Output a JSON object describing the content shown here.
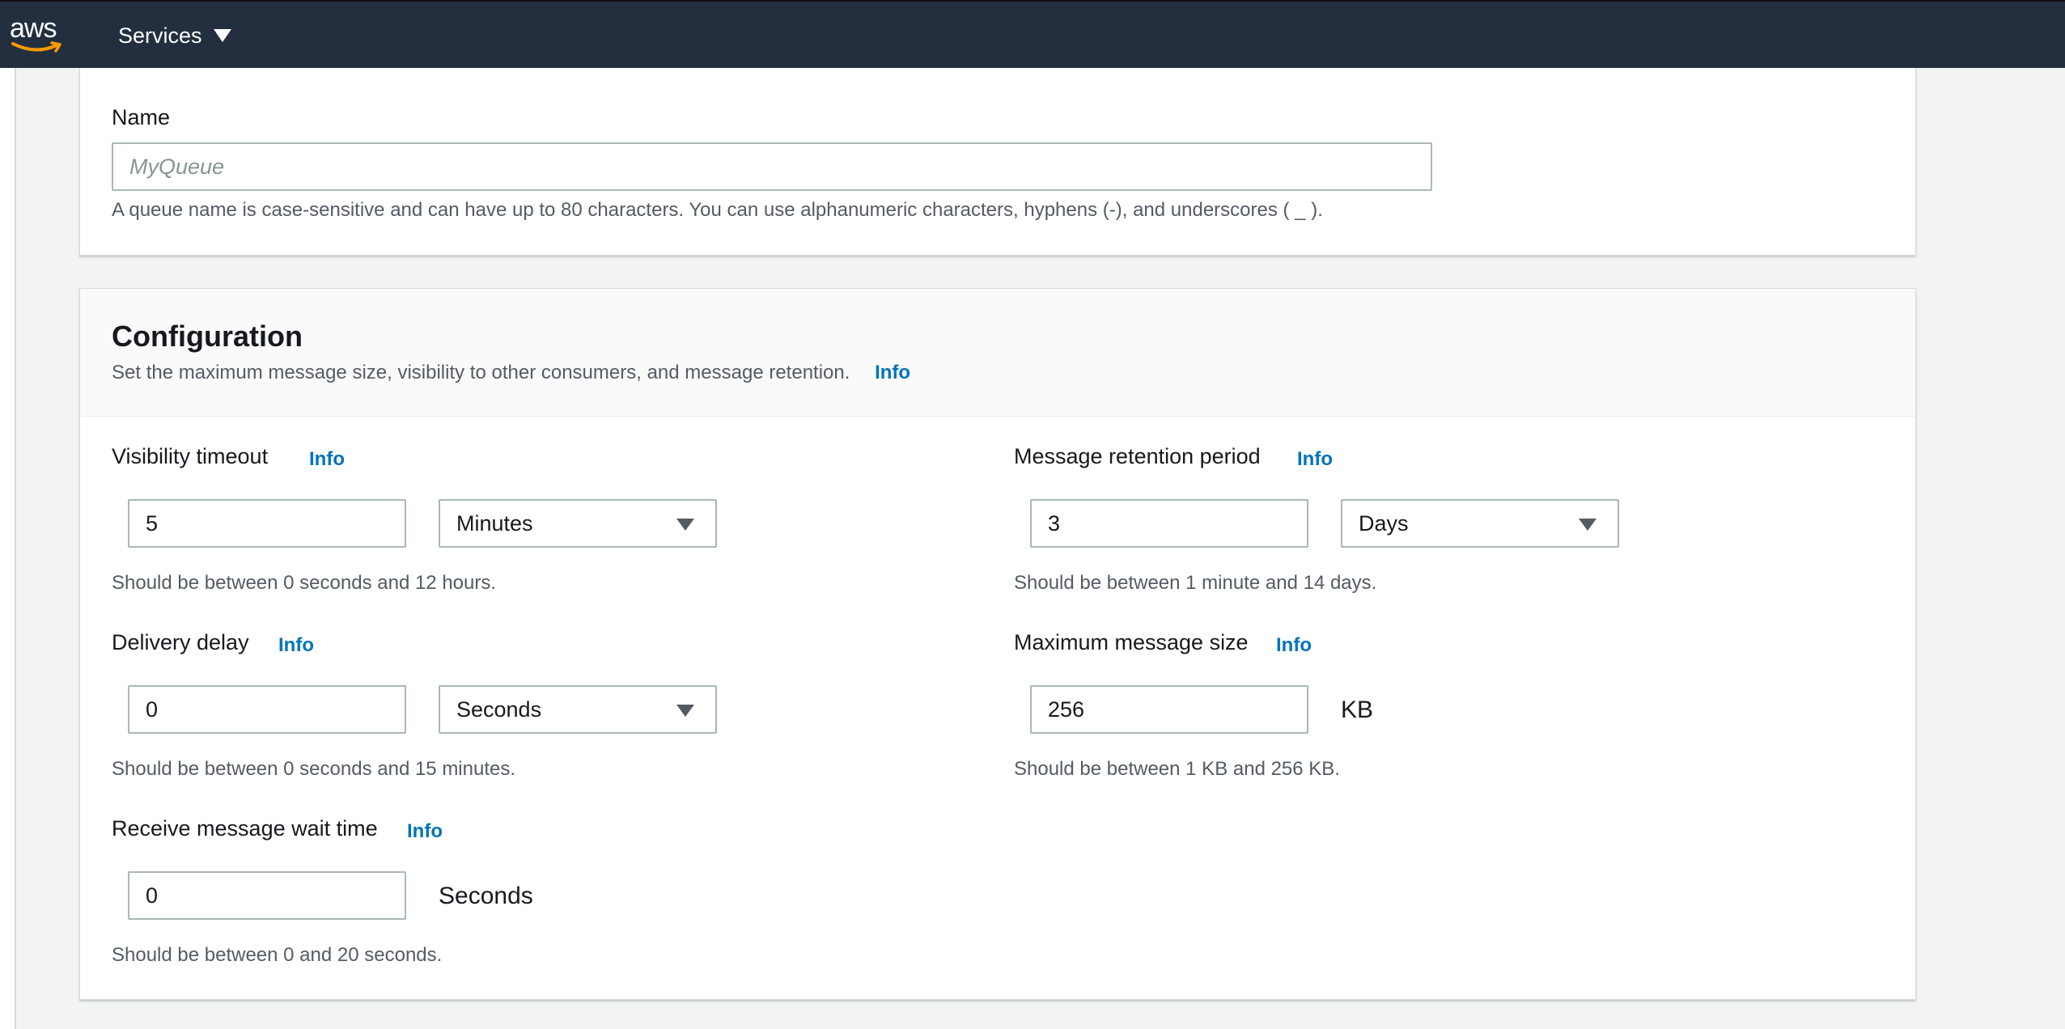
{
  "nav": {
    "logo_text": "aws",
    "services_label": "Services"
  },
  "name_section": {
    "label": "Name",
    "placeholder": "MyQueue",
    "value": "",
    "hint": "A queue name is case-sensitive and can have up to 80 characters. You can use alphanumeric characters, hyphens (-), and underscores ( _ )."
  },
  "configuration": {
    "title": "Configuration",
    "description": "Set the maximum message size, visibility to other consumers, and message retention.",
    "info": "Info",
    "visibility_timeout": {
      "label": "Visibility timeout",
      "info": "Info",
      "value": "5",
      "unit": "Minutes",
      "hint": "Should be between 0 seconds and 12 hours."
    },
    "delivery_delay": {
      "label": "Delivery delay",
      "info": "Info",
      "value": "0",
      "unit": "Seconds",
      "hint": "Should be between 0 seconds and 15 minutes."
    },
    "receive_wait_time": {
      "label": "Receive message wait time",
      "info": "Info",
      "value": "0",
      "unit": "Seconds",
      "hint": "Should be between 0 and 20 seconds."
    },
    "retention_period": {
      "label": "Message retention period",
      "info": "Info",
      "value": "3",
      "unit": "Days",
      "hint": "Should be between 1 minute and 14 days."
    },
    "max_message_size": {
      "label": "Maximum message size",
      "info": "Info",
      "value": "256",
      "unit": "KB",
      "hint": "Should be between 1 KB and 256 KB."
    }
  },
  "colors": {
    "nav_bg": "#232f3e",
    "link": "#0073bb",
    "logo_smile": "#ff9900"
  }
}
